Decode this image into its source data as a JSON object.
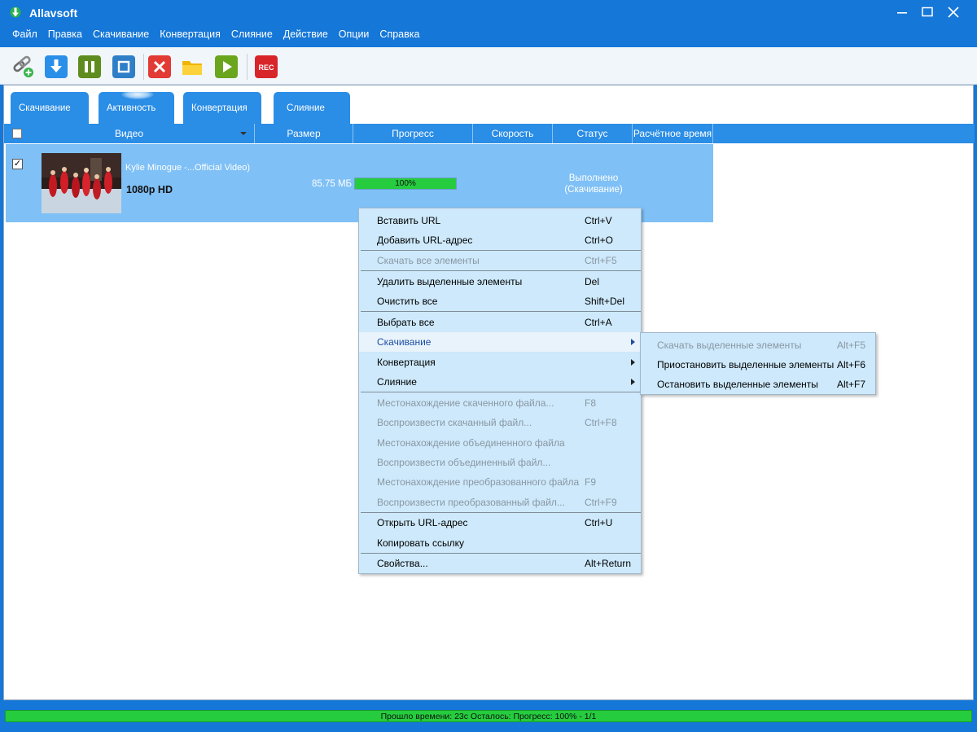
{
  "window": {
    "title": "Allavsoft"
  },
  "menu": [
    "Файл",
    "Правка",
    "Скачивание",
    "Конвертация",
    "Слияние",
    "Действие",
    "Опции",
    "Справка"
  ],
  "toolbar": {
    "rec_label": "REC"
  },
  "tabs": [
    "Скачивание",
    "Активность",
    "Конвертация",
    "Слияние"
  ],
  "active_tab": "Активность",
  "table": {
    "headers": [
      "Видео",
      "Размер",
      "Прогресс",
      "Скорость",
      "Статус",
      "Расчётное время"
    ],
    "rows": [
      {
        "checked": true,
        "checkmark": "✓",
        "title": "Kylie Minogue -...Official Video)",
        "quality": "1080p HD",
        "size": "85.75 МБ",
        "progress_text": "100%",
        "progress_value": 100,
        "status_line1": "Выполнено",
        "status_line2": "(Скачивание)"
      }
    ]
  },
  "context_menu": {
    "items": [
      {
        "label": "Вставить URL",
        "shortcut": "Ctrl+V",
        "disabled": false
      },
      {
        "label": "Добавить URL-адрес",
        "shortcut": "Ctrl+O",
        "disabled": false
      },
      {
        "label": "Скачать все элементы",
        "shortcut": "Ctrl+F5",
        "disabled": true
      },
      {
        "label": "Удалить выделенные элементы",
        "shortcut": "Del",
        "disabled": false
      },
      {
        "label": "Очистить все",
        "shortcut": "Shift+Del",
        "disabled": false
      },
      {
        "label": "Выбрать все",
        "shortcut": "Ctrl+A",
        "disabled": false
      },
      {
        "label": "Скачивание",
        "shortcut": "",
        "disabled": false,
        "submenu": true,
        "highlighted": true
      },
      {
        "label": "Конвертация",
        "shortcut": "",
        "disabled": false,
        "submenu": true
      },
      {
        "label": "Слияние",
        "shortcut": "",
        "disabled": false,
        "submenu": true
      },
      {
        "label": "Местонахождение скаченного файла...",
        "shortcut": "F8",
        "disabled": true
      },
      {
        "label": "Воспроизвести скачанный файл...",
        "shortcut": "Ctrl+F8",
        "disabled": true
      },
      {
        "label": "Местонахождение объединенного файла",
        "shortcut": "",
        "disabled": true
      },
      {
        "label": "Воспроизвести объединенный файл...",
        "shortcut": "",
        "disabled": true
      },
      {
        "label": "Местонахождение преобразованного файла",
        "shortcut": "F9",
        "disabled": true
      },
      {
        "label": "Воспроизвести преобразованный файл...",
        "shortcut": "Ctrl+F9",
        "disabled": true
      },
      {
        "label": "Открыть URL-адрес",
        "shortcut": "Ctrl+U",
        "disabled": false
      },
      {
        "label": "Копировать ссылку",
        "shortcut": "",
        "disabled": false
      },
      {
        "label": "Свойства...",
        "shortcut": "Alt+Return",
        "disabled": false
      }
    ]
  },
  "submenu": {
    "items": [
      {
        "label": "Скачать выделенные элементы",
        "shortcut": "Alt+F5",
        "disabled": true
      },
      {
        "label": "Приостановить выделенные элементы",
        "shortcut": "Alt+F6",
        "disabled": false
      },
      {
        "label": "Остановить выделенные элементы",
        "shortcut": "Alt+F7",
        "disabled": false
      }
    ]
  },
  "statusbar": {
    "text": "Прошло времени: 23с Осталось: Прогресс: 100% - 1/1",
    "progress_value": 100
  },
  "colors": {
    "chrome_blue": "#1577d8",
    "tab_blue": "#2a8de6",
    "row_selected": "#7fc0f6",
    "menu_bg": "#cde9fb",
    "progress_green": "#25cc3e"
  }
}
